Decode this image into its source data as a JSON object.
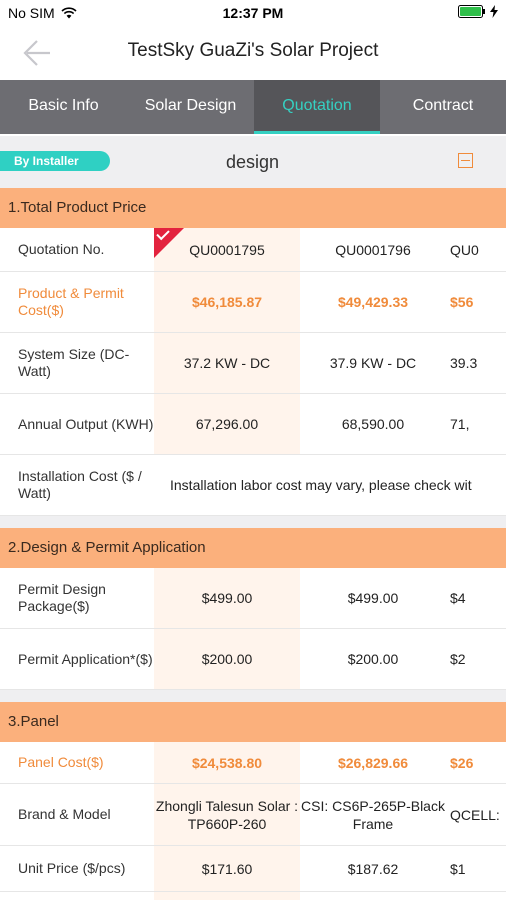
{
  "status": {
    "carrier": "No SIM",
    "time": "12:37 PM"
  },
  "nav": {
    "title": "TestSky GuaZi's Solar Project"
  },
  "tabs": [
    "Basic Info",
    "Solar Design",
    "Quotation",
    "Contract"
  ],
  "filter": {
    "badge": "By Installer",
    "label": "design"
  },
  "sections": {
    "s1": {
      "title": "1.Total Product Price",
      "quotation": {
        "label": "Quotation No.",
        "values": [
          "QU0001795",
          "QU0001796",
          "QU0"
        ]
      },
      "cost": {
        "label": "Product & Permit Cost($)",
        "values": [
          "$46,185.87",
          "$49,429.33",
          "$56"
        ]
      },
      "size": {
        "label": "System Size (DC-Watt)",
        "values": [
          "37.2 KW - DC",
          "37.9 KW - DC",
          "39.3"
        ]
      },
      "output": {
        "label": "Annual Output (KWH)",
        "values": [
          "67,296.00",
          "68,590.00",
          "71,"
        ]
      },
      "install": {
        "label": "Installation Cost ($ / Watt)",
        "note": "Installation labor cost may vary, please check wit"
      }
    },
    "s2": {
      "title": "2.Design & Permit Application",
      "design_pkg": {
        "label": "Permit Design Package($)",
        "values": [
          "$499.00",
          "$499.00",
          "$4"
        ]
      },
      "permit_app": {
        "label": "Permit Application*($)",
        "values": [
          "$200.00",
          "$200.00",
          "$2"
        ]
      }
    },
    "s3": {
      "title": "3.Panel",
      "panel_cost": {
        "label": "Panel Cost($)",
        "values": [
          "$24,538.80",
          "$26,829.66",
          "$26"
        ]
      },
      "brand": {
        "label": "Brand & Model",
        "values": [
          "Zhongli Talesun Solar : TP660P-260",
          "CSI: CS6P-265P-Black Frame",
          "QCELL:"
        ]
      },
      "unit_price": {
        "label": "Unit Price ($/pcs)",
        "values": [
          "$171.60",
          "$187.62",
          "$1"
        ]
      }
    }
  }
}
